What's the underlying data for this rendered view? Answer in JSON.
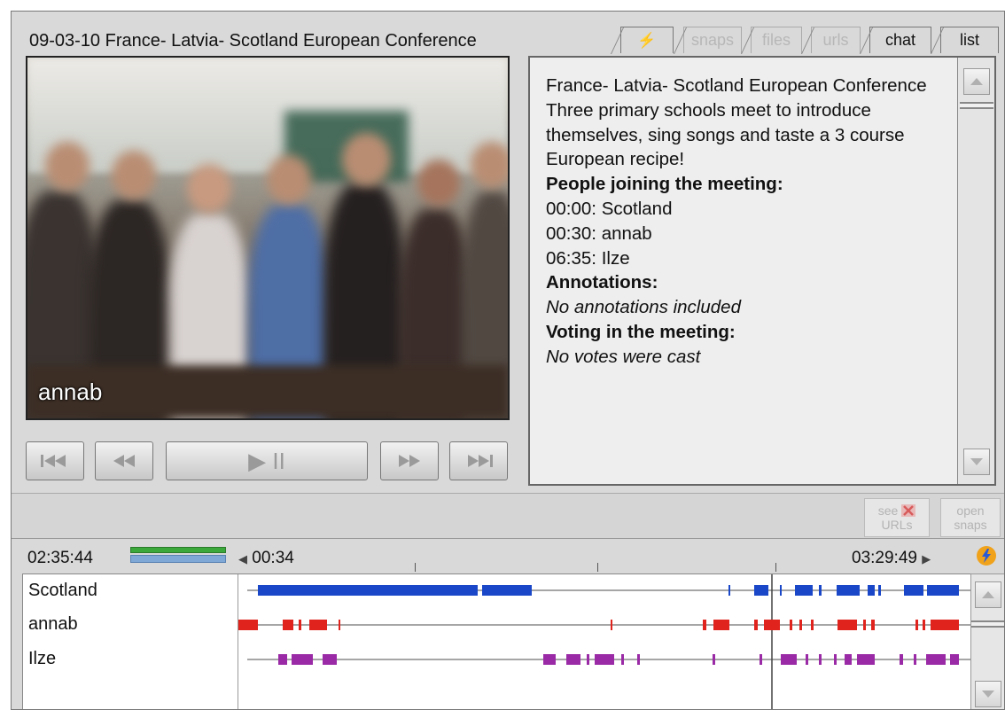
{
  "header": {
    "title": "09-03-10  France- Latvia- Scotland European Conference"
  },
  "tabs": [
    {
      "label": "⚡",
      "name": "tab-bolt",
      "state": "active"
    },
    {
      "label": "snaps",
      "name": "tab-snaps",
      "state": "disabled"
    },
    {
      "label": "files",
      "name": "tab-files",
      "state": "disabled"
    },
    {
      "label": "urls",
      "name": "tab-urls",
      "state": "disabled"
    },
    {
      "label": "chat",
      "name": "tab-chat",
      "state": "normal"
    },
    {
      "label": "list",
      "name": "tab-list",
      "state": "normal"
    }
  ],
  "video": {
    "participant_label": "annab"
  },
  "transport": {
    "first_icon": "skip-to-start-icon",
    "prev_icon": "rewind-icon",
    "play_icon": "play-pause-icon",
    "next_icon": "fast-forward-icon",
    "last_icon": "skip-to-end-icon",
    "play_glyph": "▶ II"
  },
  "info": {
    "meeting_title": "France- Latvia- Scotland European Conference",
    "description": "Three primary schools meet to introduce themselves, sing songs and taste a 3 course European recipe!",
    "people_heading": "People joining the meeting:",
    "people": [
      "00:00: Scotland",
      "00:30: annab",
      "06:35: Ilze"
    ],
    "annotations_heading": "Annotations:",
    "annotations_text": "No annotations included",
    "voting_heading": "Voting in the meeting:",
    "voting_text": "No votes were cast"
  },
  "midbar": {
    "see_urls_label_1": "see",
    "see_urls_label_2": "URLs",
    "open_snaps_label_1": "open",
    "open_snaps_label_2": "snaps"
  },
  "timeline": {
    "current_time": "02:35:44",
    "position_start": "00:34",
    "position_end": "03:29:49",
    "start_arrow": "◀",
    "end_arrow": "▶",
    "tracks": [
      {
        "name": "Scotland",
        "color": "#1a47c8"
      },
      {
        "name": "annab",
        "color": "#e0231d"
      },
      {
        "name": "Ilze",
        "color": "#9a2aa6"
      }
    ]
  },
  "colors": {
    "volume_green": "#3aa83a",
    "volume_blue": "#7fa8d6",
    "bolt_orange": "#f0a21a",
    "bolt_blue": "#2a5bd7"
  }
}
